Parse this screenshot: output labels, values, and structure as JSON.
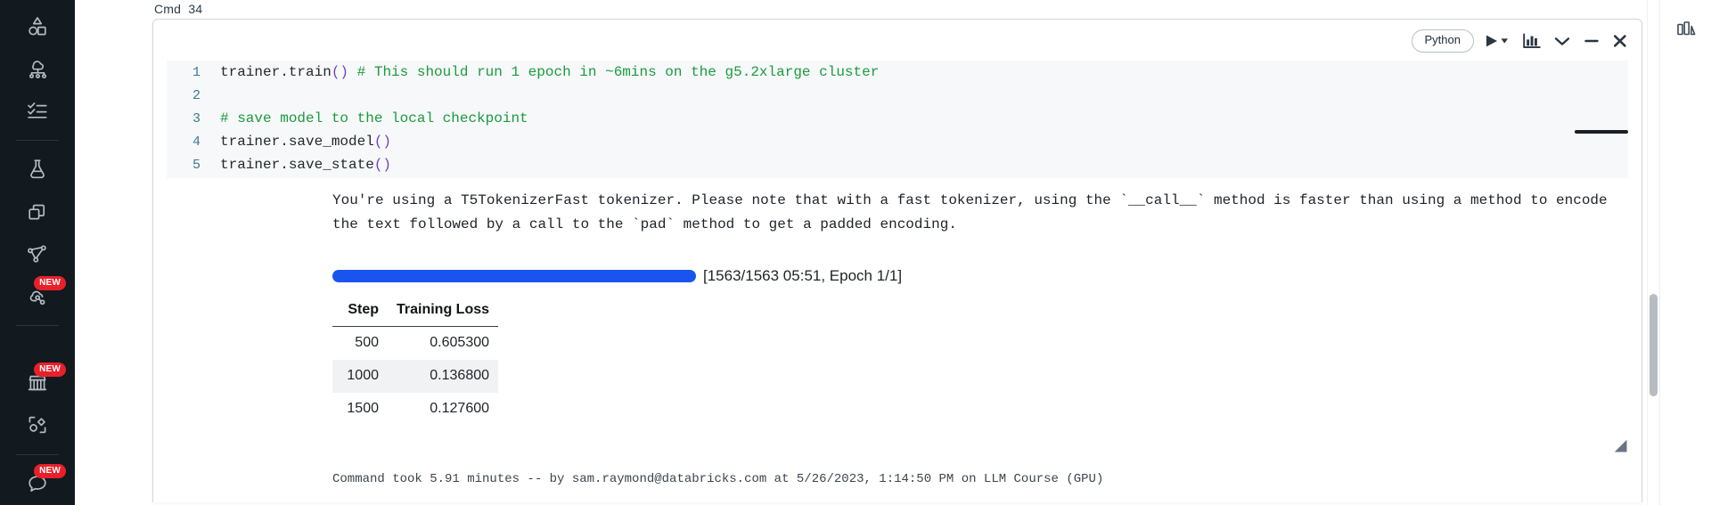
{
  "sidebar": {
    "items": [
      {
        "name": "new-shapes",
        "icon": "shapes-icon",
        "badge": null
      },
      {
        "name": "compute",
        "icon": "cloud-network-icon",
        "badge": null
      },
      {
        "name": "workflows",
        "icon": "checklist-icon",
        "badge": null
      },
      {
        "name": "experiments",
        "icon": "flask-icon",
        "badge": null
      },
      {
        "name": "models",
        "icon": "stacked-squares-icon",
        "badge": null
      },
      {
        "name": "feature-store",
        "icon": "graph-nodes-icon",
        "badge": null
      },
      {
        "name": "serving",
        "icon": "cloud-link-icon",
        "badge": "NEW"
      },
      {
        "name": "marketplace",
        "icon": "storefront-icon",
        "badge": "NEW"
      },
      {
        "name": "partner-connect",
        "icon": "shapes-connect-icon",
        "badge": null
      },
      {
        "name": "assistant",
        "icon": "chat-icon",
        "badge": "NEW"
      }
    ],
    "badge_color": "#e8202a"
  },
  "right_rail": {
    "items": [
      {
        "name": "dashboard-chart",
        "icon": "bar-chart-icon"
      }
    ]
  },
  "cell": {
    "label": "Cmd  34",
    "toolbar": {
      "language": "Python",
      "run_label": "run-icon",
      "run_caret_label": "caret-down-icon",
      "chart_label": "bar-chart-icon",
      "collapse_label": "chevron-down-icon",
      "minimize_label": "minus-icon",
      "close_label": "close-icon"
    },
    "code_lines": [
      {
        "no": "1",
        "pre": "trainer.train",
        "paren": "()",
        "post": " ",
        "comment": "# This should run 1 epoch in ~6mins on the g5.2xlarge cluster"
      },
      {
        "no": "2",
        "pre": "",
        "paren": "",
        "post": "",
        "comment": ""
      },
      {
        "no": "3",
        "pre": "",
        "paren": "",
        "post": "",
        "comment": "# save model to the local checkpoint"
      },
      {
        "no": "4",
        "pre": "trainer.save_model",
        "paren": "()",
        "post": "",
        "comment": ""
      },
      {
        "no": "5",
        "pre": "trainer.save_state",
        "paren": "()",
        "post": "",
        "comment": ""
      }
    ],
    "output": {
      "warning_line1": "You're using a T5TokenizerFast tokenizer. Please note that with a fast tokenizer, using the `__call__` method is faster than using a method to encode",
      "warning_line2": "the text followed by a call to the `pad` method to get a padded encoding.",
      "progress": {
        "percent": 100,
        "status": "[1563/1563 05:51, Epoch 1/1]"
      },
      "table": {
        "columns": [
          "Step",
          "Training Loss"
        ],
        "rows": [
          [
            "500",
            "0.605300"
          ],
          [
            "1000",
            "0.136800"
          ],
          [
            "1500",
            "0.127600"
          ]
        ]
      }
    },
    "footer": "Command took 5.91 minutes -- by sam.raymond@databricks.com at 5/26/2023, 1:14:50 PM on LLM Course (GPU)"
  },
  "colors": {
    "progress_blue": "#1a54ef",
    "sidebar_bg": "#12191f",
    "badge_red": "#e8202a",
    "comment_green": "#1a9b3f",
    "paren_purple": "#6f42c1",
    "lineno_blue": "#3d7a96"
  }
}
